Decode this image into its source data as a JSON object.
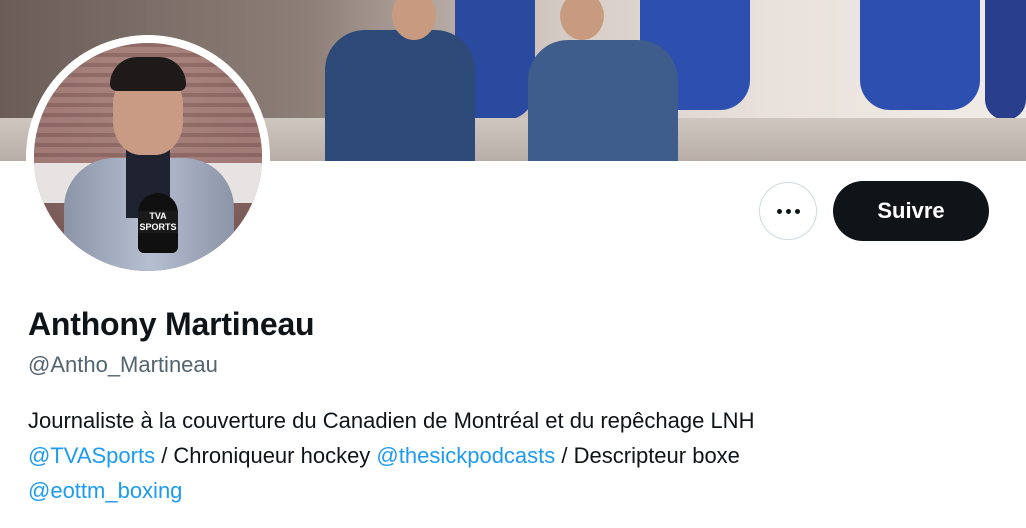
{
  "profile": {
    "display_name": "Anthony Martineau",
    "handle": "@Antho_Martineau",
    "bio_line1": "Journaliste à la couverture du Canadien de Montréal et du repêchage LNH",
    "bio_link1": "@TVASports",
    "bio_text2": " / Chroniqueur hockey ",
    "bio_link2": "@thesickpodcasts",
    "bio_text3": " / Descripteur boxe",
    "bio_link3": "@eottm_boxing",
    "avatar_mic_label": "TVA SPORTS"
  },
  "actions": {
    "more_icon": "more-horizontal-icon",
    "follow_label": "Suivre"
  },
  "colors": {
    "link": "#1d9bf0",
    "text": "#0f1419",
    "secondary": "#536471",
    "follow_bg": "#0f1419"
  }
}
